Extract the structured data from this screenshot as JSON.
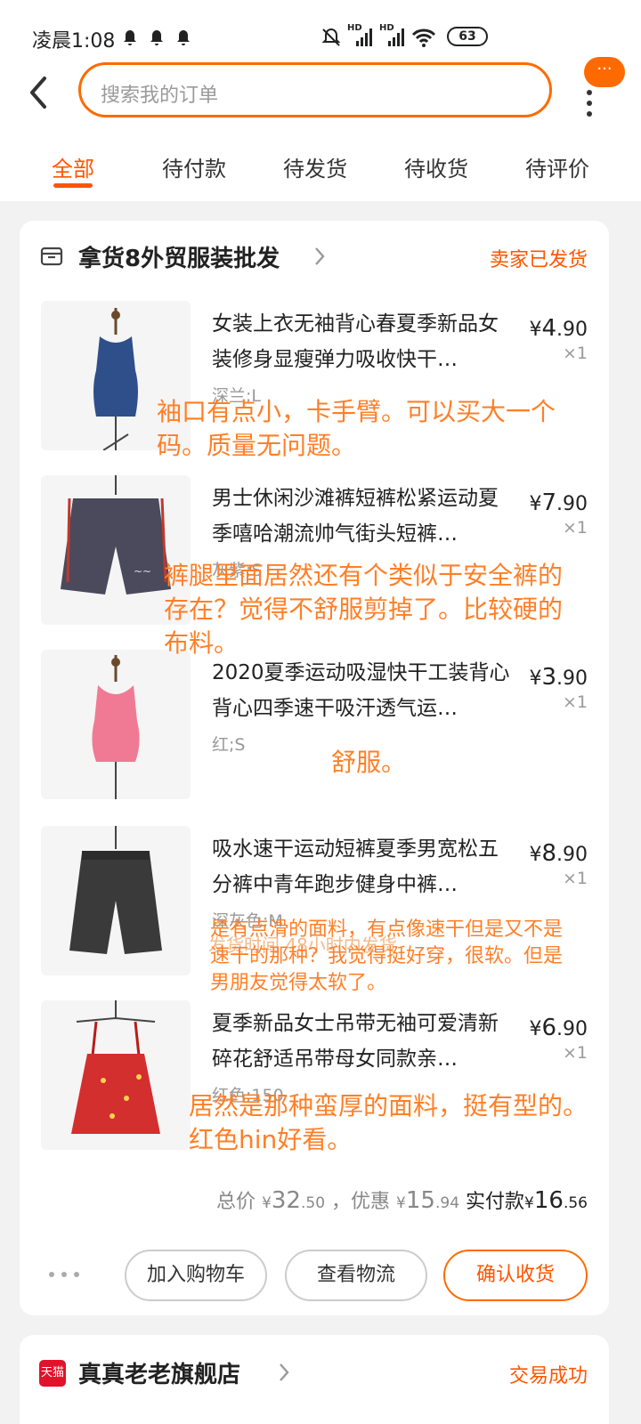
{
  "status_bar": {
    "time": "凌晨1:08",
    "battery": "63",
    "network_1": "HD",
    "network_2": "HD"
  },
  "header": {
    "search_placeholder": "搜索我的订单",
    "bubble": "···"
  },
  "tabs": [
    "全部",
    "待付款",
    "待发货",
    "待收货",
    "待评价"
  ],
  "order": {
    "shop_name": "拿货8外贸服装批发",
    "status": "卖家已发货",
    "items": [
      {
        "title": "女装上衣无袖背心春夏季新品女装修身显瘦弹力吸收快干…",
        "sku": "深兰;L",
        "price_symbol": "¥",
        "price_int": "4",
        "price_dec": ".90",
        "qty": "×1"
      },
      {
        "title": "男士休闲沙滩裤短裤松紧运动夏季嘻哈潮流帅气街头短裤…",
        "sku": "灰紫;S",
        "price_symbol": "¥",
        "price_int": "7",
        "price_dec": ".90",
        "qty": "×1"
      },
      {
        "title": "2020夏季运动吸湿快干工装背心背心四季速干吸汗透气运…",
        "sku": "红;S",
        "price_symbol": "¥",
        "price_int": "3",
        "price_dec": ".90",
        "qty": "×1"
      },
      {
        "title": "吸水速干运动短裤夏季男宽松五分裤中青年跑步健身中裤…",
        "sku": "深灰色;M",
        "price_symbol": "¥",
        "price_int": "8",
        "price_dec": ".90",
        "qty": "×1"
      },
      {
        "title": "夏季新品女士吊带无袖可爱清新碎花舒适吊带母女同款亲…",
        "sku": "红色;150",
        "price_symbol": "¥",
        "price_int": "6",
        "price_dec": ".90",
        "qty": "×1"
      }
    ],
    "notes": [
      "袖口有点小，卡手臂。可以买大一个码。质量无问题。",
      "裤腿里面居然还有个类似于安全裤的存在？觉得不舒服剪掉了。比较硬的布料。",
      "舒服。",
      "是有点滑的面料，有点像速干但是又不是速干的那种？我觉得挺好穿，很软。但是男朋友觉得太软了。",
      "居然是那种蛮厚的面料，挺有型的。红色hin好看。"
    ],
    "ghost_text": "发货时间 48小时内发货",
    "total": {
      "label_total": "总价",
      "total_symbol": "¥",
      "total_int": "32",
      "total_dec": ".50",
      "label_discount": "，优惠",
      "discount_symbol": "¥",
      "discount_int": "15",
      "discount_dec": ".94",
      "label_pay": "实付款",
      "pay_symbol": "¥",
      "pay_int": "16",
      "pay_dec": ".56"
    },
    "buttons": {
      "add_cart": "加入购物车",
      "logistics": "查看物流",
      "confirm": "确认收货"
    }
  },
  "order2": {
    "shop_badge": "天猫",
    "shop_name": "真真老老旗舰店",
    "status": "交易成功"
  },
  "colors": {
    "accent": "#ff5500",
    "note": "#ff7f27"
  }
}
